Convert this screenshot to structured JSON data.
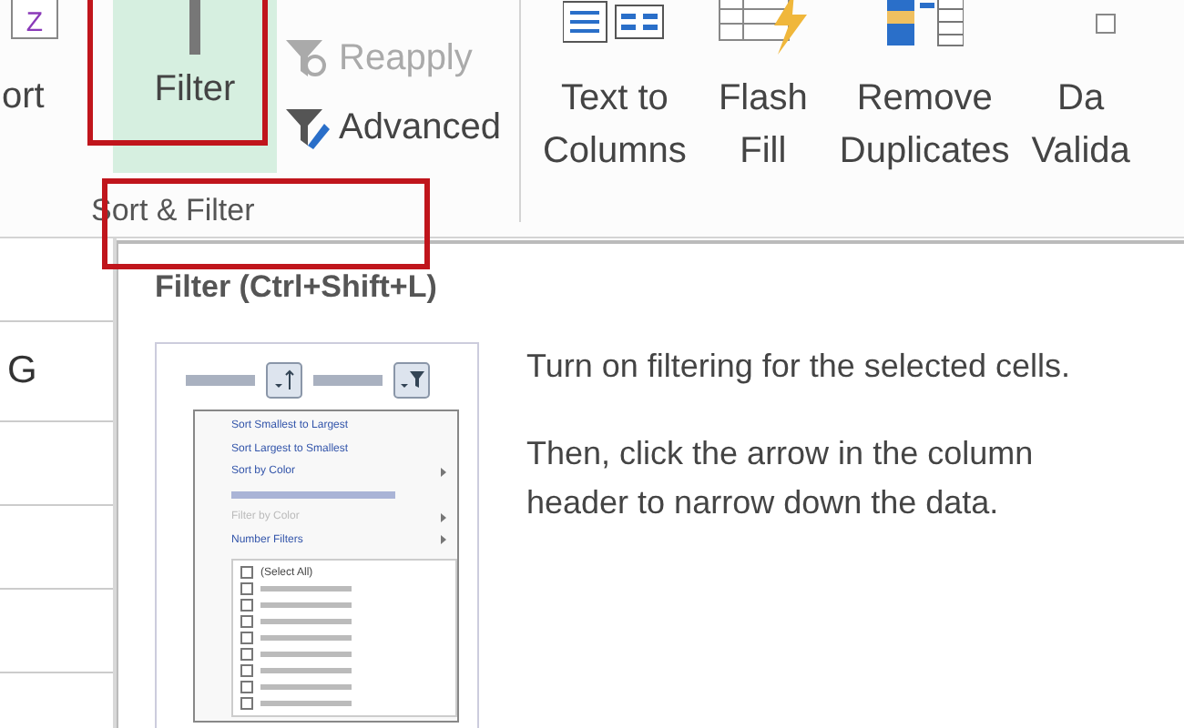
{
  "ribbon": {
    "sort_icon_letter": "Z",
    "sort_cut_label": "ort",
    "filter_button": {
      "label": "Filter",
      "selected": true
    },
    "small_buttons": [
      {
        "label": "Reapply",
        "disabled": true
      },
      {
        "label": "Advanced",
        "disabled": false
      }
    ],
    "group_label": "Sort & Filter",
    "tools": [
      {
        "kind": "text-columns",
        "lines": [
          "Text to",
          "Columns"
        ]
      },
      {
        "kind": "flash",
        "lines": [
          "Flash",
          "Fill"
        ]
      },
      {
        "kind": "duplicates",
        "lines": [
          "Remove",
          "Duplicates"
        ]
      },
      {
        "kind": "validation",
        "lines": [
          "Da",
          "Valida"
        ]
      }
    ]
  },
  "sheet": {
    "cell_text": "G"
  },
  "tooltip": {
    "title": "Filter (Ctrl+Shift+L)",
    "paragraphs": [
      "Turn on filtering for the selected cells.",
      "Then, click the arrow in the column header to narrow down the data."
    ],
    "preview_menu": [
      {
        "label": "Sort Smallest to Largest",
        "kind": "item",
        "disabled": false
      },
      {
        "label": "Sort Largest to Smallest",
        "kind": "item",
        "disabled": false
      },
      {
        "label": "Sort by Color",
        "kind": "submenu",
        "disabled": false
      },
      {
        "kind": "blur"
      },
      {
        "label": "Filter by Color",
        "kind": "submenu",
        "disabled": true
      },
      {
        "label": "Number Filters",
        "kind": "submenu",
        "disabled": false
      }
    ],
    "preview_list": [
      {
        "label": "(Select All)"
      }
    ]
  }
}
